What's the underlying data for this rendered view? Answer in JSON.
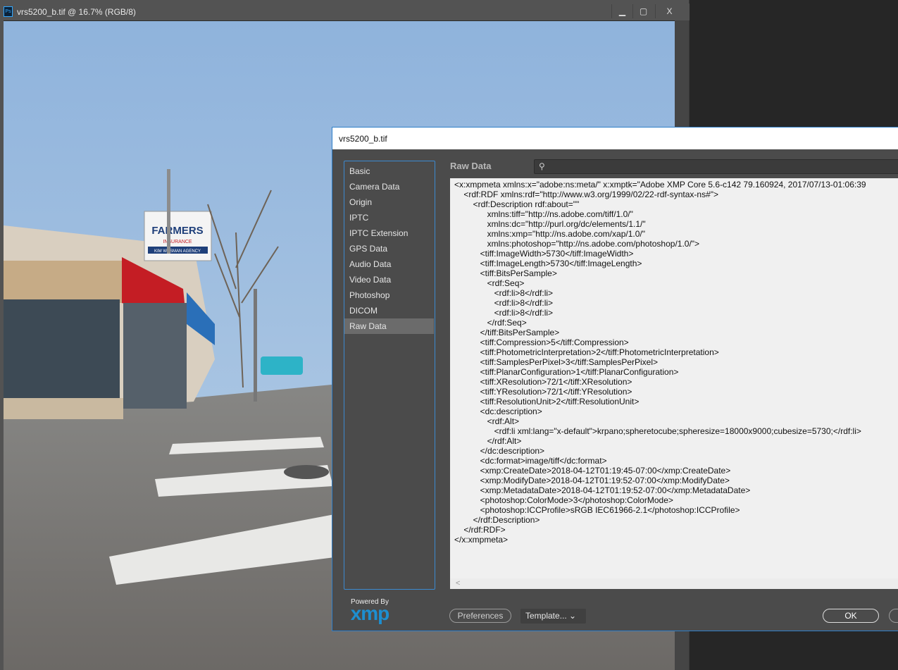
{
  "document": {
    "title": "vrs5200_b.tif @ 16.7% (RGB/8)",
    "app_icon": "Ps",
    "controls": {
      "minimize": "▁",
      "maximize": "▢",
      "close": "X"
    }
  },
  "photo": {
    "sign_title": "FARMERS",
    "sign_sub": "INSURANCE",
    "sign_agency": "KIM WESMAN AGENCY"
  },
  "dialog": {
    "title": "vrs5200_b.tif",
    "sidebar": {
      "items": [
        {
          "label": "Basic"
        },
        {
          "label": "Camera Data"
        },
        {
          "label": "Origin"
        },
        {
          "label": "IPTC"
        },
        {
          "label": "IPTC Extension"
        },
        {
          "label": "GPS Data"
        },
        {
          "label": "Audio Data"
        },
        {
          "label": "Video Data"
        },
        {
          "label": "Photoshop"
        },
        {
          "label": "DICOM"
        },
        {
          "label": "Raw Data",
          "selected": true
        }
      ]
    },
    "section_label": "Raw Data",
    "search": {
      "value": "",
      "icon": "search-icon"
    },
    "raw_lines": [
      "<x:xmpmeta xmlns:x=\"adobe:ns:meta/\" x:xmptk=\"Adobe XMP Core 5.6-c142 79.160924, 2017/07/13-01:06:39",
      "    <rdf:RDF xmlns:rdf=\"http://www.w3.org/1999/02/22-rdf-syntax-ns#\">",
      "        <rdf:Description rdf:about=\"\"",
      "              xmlns:tiff=\"http://ns.adobe.com/tiff/1.0/\"",
      "              xmlns:dc=\"http://purl.org/dc/elements/1.1/\"",
      "              xmlns:xmp=\"http://ns.adobe.com/xap/1.0/\"",
      "              xmlns:photoshop=\"http://ns.adobe.com/photoshop/1.0/\">",
      "           <tiff:ImageWidth>5730</tiff:ImageWidth>",
      "           <tiff:ImageLength>5730</tiff:ImageLength>",
      "           <tiff:BitsPerSample>",
      "              <rdf:Seq>",
      "                 <rdf:li>8</rdf:li>",
      "                 <rdf:li>8</rdf:li>",
      "                 <rdf:li>8</rdf:li>",
      "              </rdf:Seq>",
      "           </tiff:BitsPerSample>",
      "           <tiff:Compression>5</tiff:Compression>",
      "           <tiff:PhotometricInterpretation>2</tiff:PhotometricInterpretation>",
      "           <tiff:SamplesPerPixel>3</tiff:SamplesPerPixel>",
      "           <tiff:PlanarConfiguration>1</tiff:PlanarConfiguration>",
      "           <tiff:XResolution>72/1</tiff:XResolution>",
      "           <tiff:YResolution>72/1</tiff:YResolution>",
      "           <tiff:ResolutionUnit>2</tiff:ResolutionUnit>",
      "           <dc:description>",
      "              <rdf:Alt>",
      "                 <rdf:li xml:lang=\"x-default\">krpano;spheretocube;spheresize=18000x9000;cubesize=5730;</rdf:li>",
      "              </rdf:Alt>",
      "           </dc:description>",
      "           <dc:format>image/tiff</dc:format>",
      "           <xmp:CreateDate>2018-04-12T01:19:45-07:00</xmp:CreateDate>",
      "           <xmp:ModifyDate>2018-04-12T01:19:52-07:00</xmp:ModifyDate>",
      "           <xmp:MetadataDate>2018-04-12T01:19:52-07:00</xmp:MetadataDate>",
      "           <photoshop:ColorMode>3</photoshop:ColorMode>",
      "           <photoshop:ICCProfile>sRGB IEC61966-2.1</photoshop:ICCProfile>",
      "        </rdf:Description>",
      "    </rdf:RDF>",
      "</x:xmpmeta>"
    ],
    "scroll_left": "<",
    "logo": {
      "powered_by": "Powered By",
      "brand": "xmp"
    },
    "buttons": {
      "preferences": "Preferences",
      "template": "Template...",
      "template_chevron": "⌄",
      "ok": "OK"
    }
  }
}
